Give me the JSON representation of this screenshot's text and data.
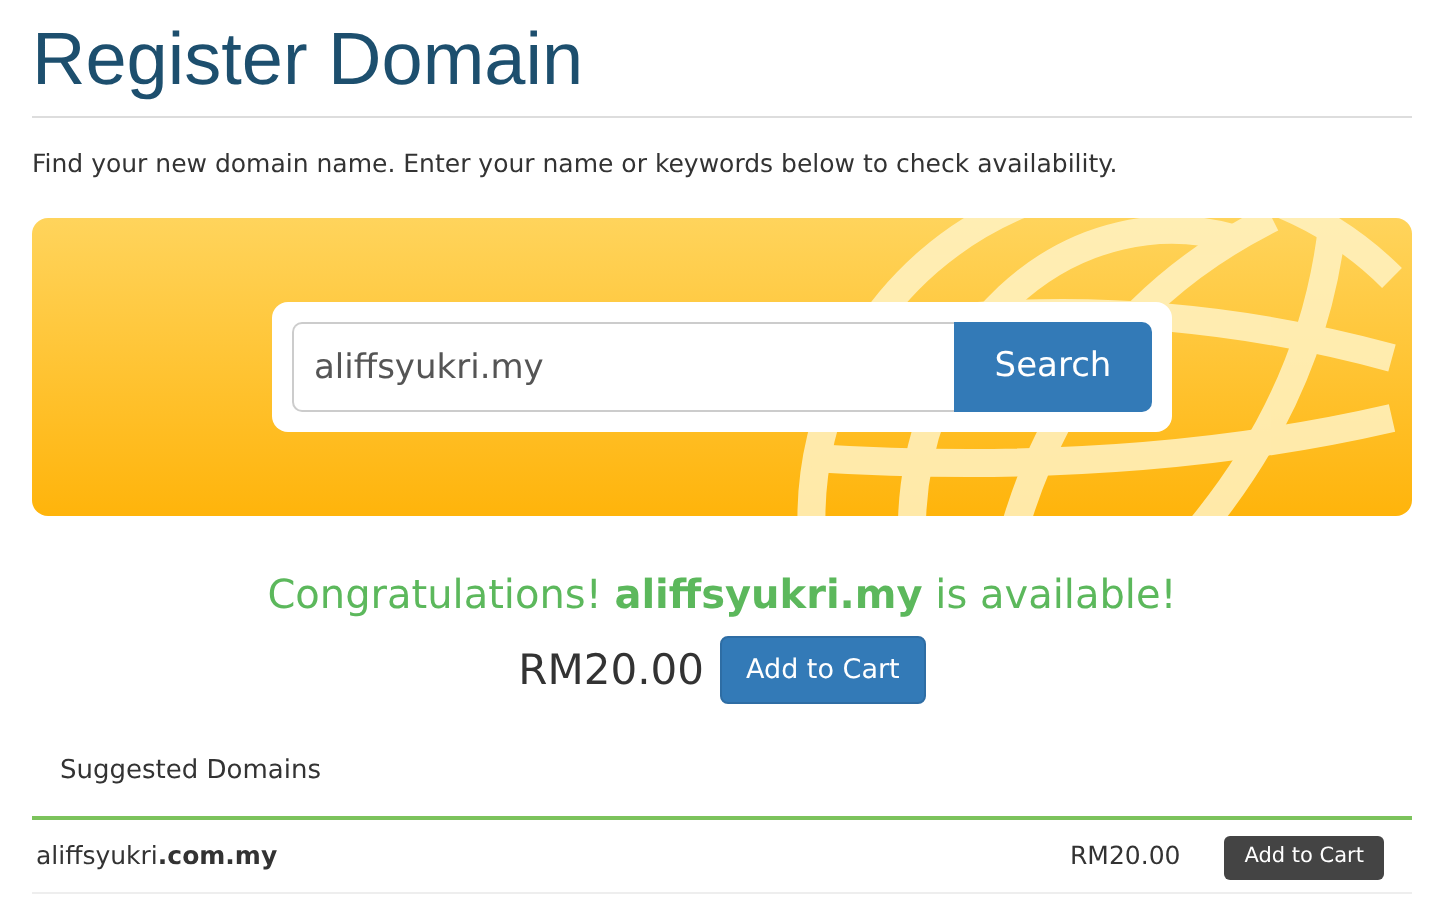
{
  "page": {
    "title": "Register Domain",
    "description": "Find your new domain name. Enter your name or keywords below to check availability."
  },
  "search": {
    "value": "aliffsyukri.my",
    "button": "Search"
  },
  "result": {
    "message": "Congratulations! **aliffsyukri.my** is available!",
    "price": "RM20.00",
    "button": "Add to Cart"
  },
  "suggestions": {
    "heading": "Suggested Domains",
    "rows": [
      {
        "domain": "aliffsyukri**.com.my**",
        "price": "RM20.00",
        "button": "Add to Cart"
      }
    ]
  }
}
